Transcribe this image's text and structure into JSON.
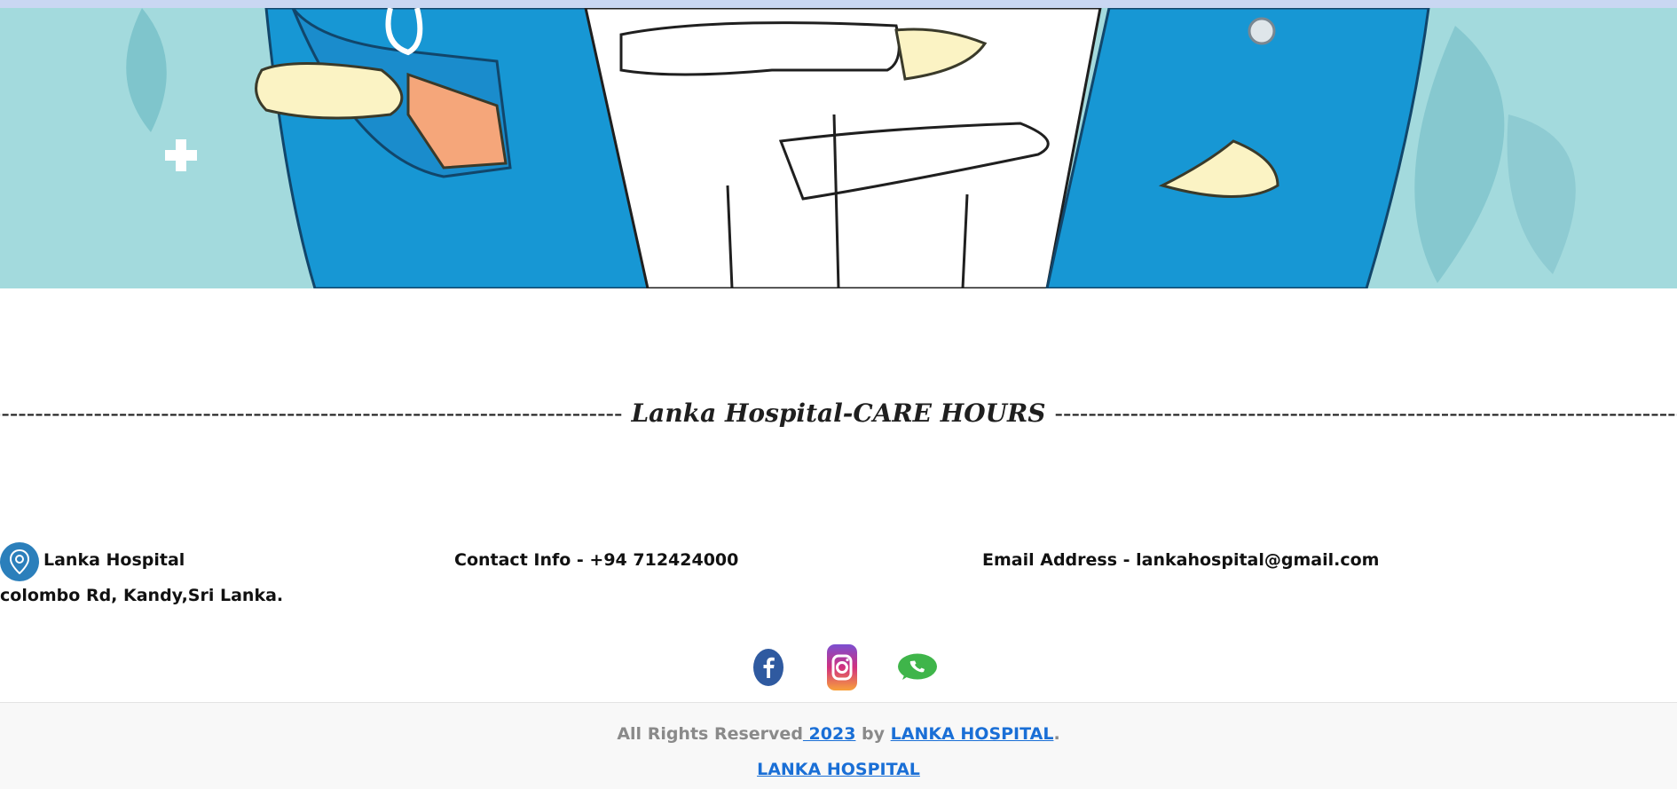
{
  "hero": {
    "image": "doctors-illustration"
  },
  "care_hours": {
    "title": "Lanka Hospital-CARE HOURS",
    "dashes_left": "-------------------------------------------------------------------------------------",
    "dashes_right": "-------------------------------------------------------------------------------------"
  },
  "contact": {
    "hospital_name": "Lanka Hospital",
    "address": "colombo Rd, Kandy,Sri Lanka.",
    "phone": "Contact Info - +94 712424000",
    "email": "Email Address - lankahospital@gmail.com",
    "pin_icon": "location-pin-icon"
  },
  "social": [
    {
      "name": "facebook-icon",
      "color": "#2f5aa0"
    },
    {
      "name": "instagram-icon",
      "color": "#c13584"
    },
    {
      "name": "whatsapp-icon",
      "color": "#3fb54a"
    }
  ],
  "footer": {
    "rights": "All Rights Reserved",
    "year": " 2023",
    "by": " by ",
    "brand_link": "LANKA HOSPITAL",
    "period": ".",
    "brand_link_2": "LANKA HOSPITAL"
  },
  "colors": {
    "link": "#1a6fd6",
    "hero_bg": "#a3dadd",
    "scrub_blue": "#1797d4",
    "footer_bg": "#f8f8f8"
  }
}
